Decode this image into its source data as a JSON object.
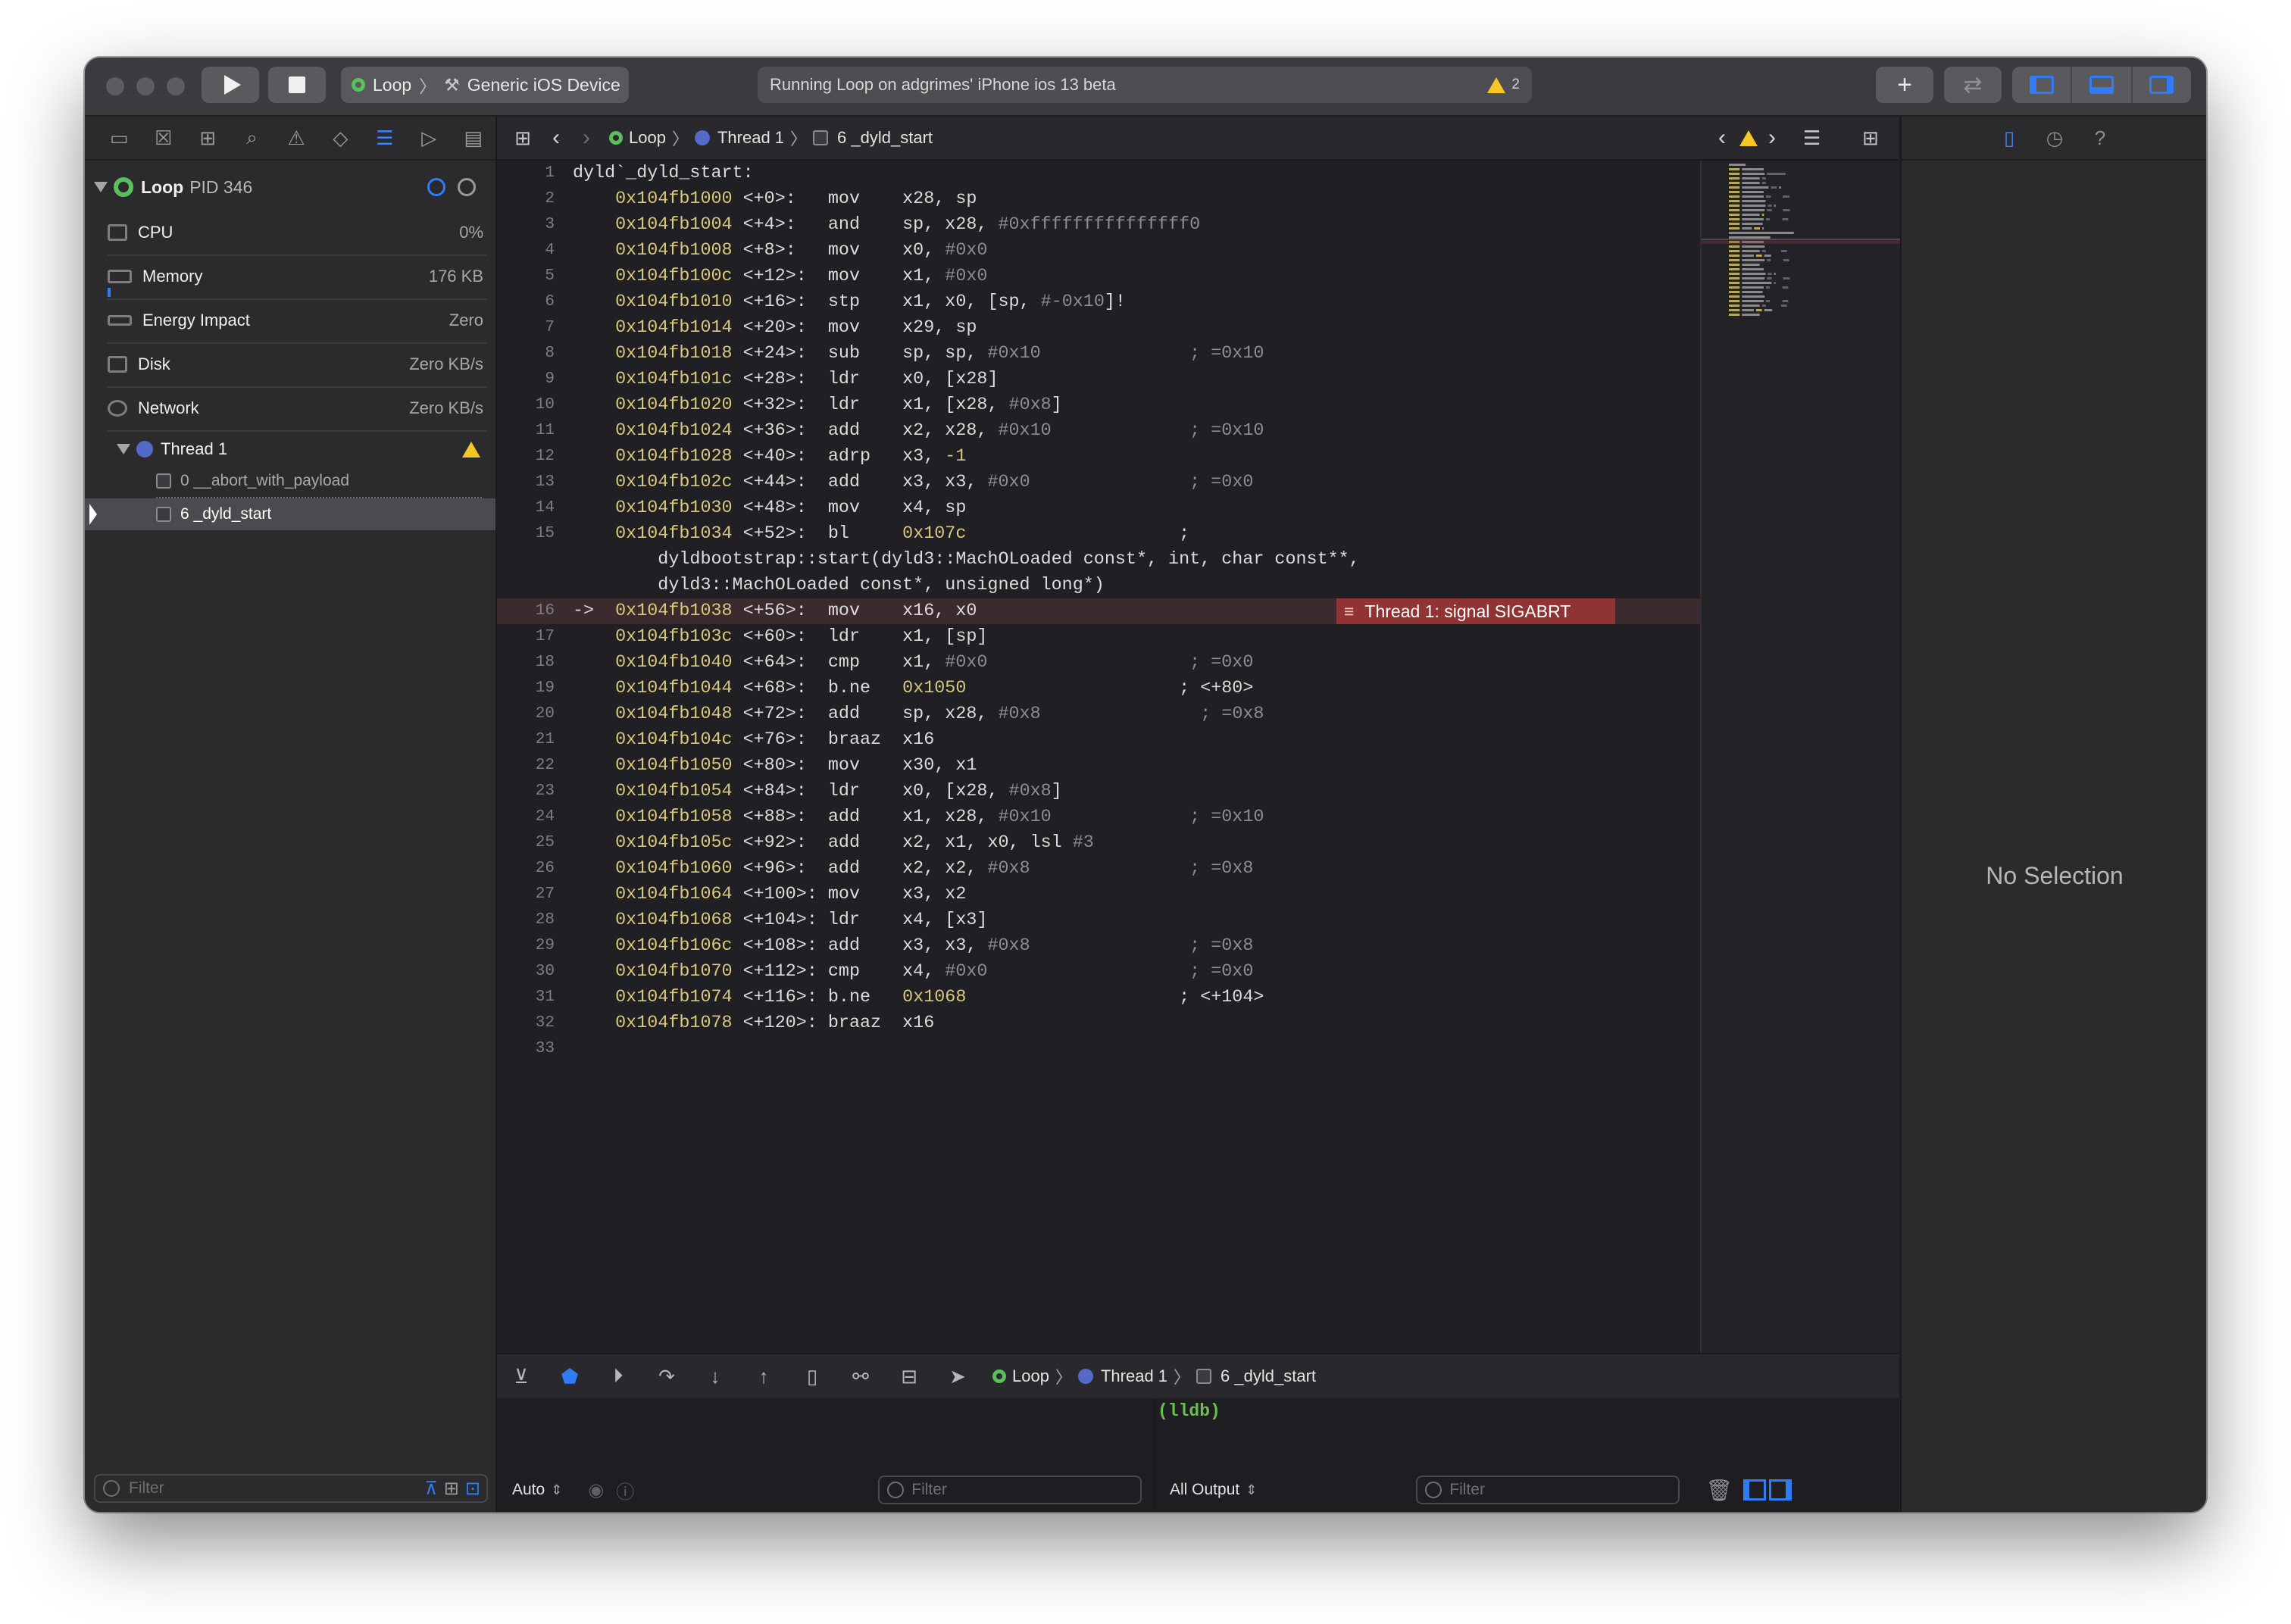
{
  "toolbar": {
    "scheme": {
      "target": "Loop",
      "device": "Generic iOS Device"
    },
    "status_text": "Running Loop on adgrimes' iPhone ios 13 beta",
    "warning_count": "2"
  },
  "navigator": {
    "process": {
      "name": "Loop",
      "pid": "PID 346"
    },
    "gauges": [
      {
        "label": "CPU",
        "value": "0%"
      },
      {
        "label": "Memory",
        "value": "176 KB"
      },
      {
        "label": "Energy Impact",
        "value": "Zero"
      },
      {
        "label": "Disk",
        "value": "Zero KB/s"
      },
      {
        "label": "Network",
        "value": "Zero KB/s"
      }
    ],
    "thread": {
      "name": "Thread 1"
    },
    "frames": [
      {
        "label": "0 __abort_with_payload"
      },
      {
        "label": "6 _dyld_start"
      }
    ],
    "filter_placeholder": "Filter"
  },
  "jumpbar": {
    "project": "Loop",
    "thread": "Thread 1",
    "frame": "6 _dyld_start"
  },
  "code": {
    "lines": [
      {
        "n": "1",
        "parts": [
          [
            "t",
            "dyld`_dyld_start:"
          ]
        ]
      },
      {
        "n": "2",
        "parts": [
          [
            "a",
            "    0x104fb1000"
          ],
          [
            "t",
            " <+0>:   mov    x28, sp"
          ]
        ]
      },
      {
        "n": "3",
        "parts": [
          [
            "a",
            "    0x104fb1004"
          ],
          [
            "t",
            " <+4>:   and    sp, x28, "
          ],
          [
            "i",
            "#0xfffffffffffffff0"
          ]
        ]
      },
      {
        "n": "4",
        "parts": [
          [
            "a",
            "    0x104fb1008"
          ],
          [
            "t",
            " <+8>:   mov    x0, "
          ],
          [
            "i",
            "#0x0"
          ]
        ]
      },
      {
        "n": "5",
        "parts": [
          [
            "a",
            "    0x104fb100c"
          ],
          [
            "t",
            " <+12>:  mov    x1, "
          ],
          [
            "i",
            "#0x0"
          ]
        ]
      },
      {
        "n": "6",
        "parts": [
          [
            "a",
            "    0x104fb1010"
          ],
          [
            "t",
            " <+16>:  stp    x1, x0, [sp, "
          ],
          [
            "i",
            "#-0x10"
          ],
          [
            "t",
            "]!"
          ]
        ]
      },
      {
        "n": "7",
        "parts": [
          [
            "a",
            "    0x104fb1014"
          ],
          [
            "t",
            " <+20>:  mov    x29, sp"
          ]
        ]
      },
      {
        "n": "8",
        "parts": [
          [
            "a",
            "    0x104fb1018"
          ],
          [
            "t",
            " <+24>:  sub    sp, sp, "
          ],
          [
            "i",
            "#0x10"
          ],
          [
            "t",
            "              "
          ],
          [
            "c",
            "; =0x10"
          ]
        ]
      },
      {
        "n": "9",
        "parts": [
          [
            "a",
            "    0x104fb101c"
          ],
          [
            "t",
            " <+28>:  ldr    x0, [x28]"
          ]
        ]
      },
      {
        "n": "10",
        "parts": [
          [
            "a",
            "    0x104fb1020"
          ],
          [
            "t",
            " <+32>:  ldr    x1, [x28, "
          ],
          [
            "i",
            "#0x8"
          ],
          [
            "t",
            "]"
          ]
        ]
      },
      {
        "n": "11",
        "parts": [
          [
            "a",
            "    0x104fb1024"
          ],
          [
            "t",
            " <+36>:  add    x2, x28, "
          ],
          [
            "i",
            "#0x10"
          ],
          [
            "t",
            "             "
          ],
          [
            "c",
            "; =0x10"
          ]
        ]
      },
      {
        "n": "12",
        "parts": [
          [
            "a",
            "    0x104fb1028"
          ],
          [
            "t",
            " <+40>:  adrp   x3, "
          ],
          [
            "a",
            "-1"
          ]
        ]
      },
      {
        "n": "13",
        "parts": [
          [
            "a",
            "    0x104fb102c"
          ],
          [
            "t",
            " <+44>:  add    x3, x3, "
          ],
          [
            "i",
            "#0x0"
          ],
          [
            "t",
            "               "
          ],
          [
            "c",
            "; =0x0"
          ]
        ]
      },
      {
        "n": "14",
        "parts": [
          [
            "a",
            "    0x104fb1030"
          ],
          [
            "t",
            " <+48>:  mov    x4, sp"
          ]
        ]
      },
      {
        "n": "15",
        "parts": [
          [
            "a",
            "    0x104fb1034"
          ],
          [
            "t",
            " <+52>:  bl     "
          ],
          [
            "a",
            "0x107c"
          ],
          [
            "t",
            "                    ;"
          ]
        ]
      },
      {
        "n": "",
        "parts": [
          [
            "t",
            "        dyldbootstrap::start(dyld3::MachOLoaded const*, int, char const**,"
          ]
        ]
      },
      {
        "n": "",
        "parts": [
          [
            "t",
            "        dyld3::MachOLoaded const*, unsigned long*)"
          ]
        ]
      },
      {
        "n": "16",
        "arrow": "->",
        "highlight": true,
        "parts": [
          [
            "a",
            "    0x104fb1038"
          ],
          [
            "t",
            " <+56>:  mov    x16, x0"
          ]
        ]
      },
      {
        "n": "17",
        "parts": [
          [
            "a",
            "    0x104fb103c"
          ],
          [
            "t",
            " <+60>:  ldr    x1, [sp]"
          ]
        ]
      },
      {
        "n": "18",
        "parts": [
          [
            "a",
            "    0x104fb1040"
          ],
          [
            "t",
            " <+64>:  cmp    x1, "
          ],
          [
            "i",
            "#0x0"
          ],
          [
            "t",
            "                   "
          ],
          [
            "c",
            "; =0x0"
          ]
        ]
      },
      {
        "n": "19",
        "parts": [
          [
            "a",
            "    0x104fb1044"
          ],
          [
            "t",
            " <+68>:  b.ne   "
          ],
          [
            "a",
            "0x1050"
          ],
          [
            "t",
            "                    ; <+80>"
          ]
        ]
      },
      {
        "n": "20",
        "parts": [
          [
            "a",
            "    0x104fb1048"
          ],
          [
            "t",
            " <+72>:  add    sp, x28, "
          ],
          [
            "i",
            "#0x8"
          ],
          [
            "t",
            "               "
          ],
          [
            "c",
            "; =0x8"
          ]
        ]
      },
      {
        "n": "21",
        "parts": [
          [
            "a",
            "    0x104fb104c"
          ],
          [
            "t",
            " <+76>:  braaz  x16"
          ]
        ]
      },
      {
        "n": "22",
        "parts": [
          [
            "a",
            "    0x104fb1050"
          ],
          [
            "t",
            " <+80>:  mov    x30, x1"
          ]
        ]
      },
      {
        "n": "23",
        "parts": [
          [
            "a",
            "    0x104fb1054"
          ],
          [
            "t",
            " <+84>:  ldr    x0, [x28, "
          ],
          [
            "i",
            "#0x8"
          ],
          [
            "t",
            "]"
          ]
        ]
      },
      {
        "n": "24",
        "parts": [
          [
            "a",
            "    0x104fb1058"
          ],
          [
            "t",
            " <+88>:  add    x1, x28, "
          ],
          [
            "i",
            "#0x10"
          ],
          [
            "t",
            "             "
          ],
          [
            "c",
            "; =0x10"
          ]
        ]
      },
      {
        "n": "25",
        "parts": [
          [
            "a",
            "    0x104fb105c"
          ],
          [
            "t",
            " <+92>:  add    x2, x1, x0, lsl "
          ],
          [
            "i",
            "#3"
          ]
        ]
      },
      {
        "n": "26",
        "parts": [
          [
            "a",
            "    0x104fb1060"
          ],
          [
            "t",
            " <+96>:  add    x2, x2, "
          ],
          [
            "i",
            "#0x8"
          ],
          [
            "t",
            "               "
          ],
          [
            "c",
            "; =0x8"
          ]
        ]
      },
      {
        "n": "27",
        "parts": [
          [
            "a",
            "    0x104fb1064"
          ],
          [
            "t",
            " <+100>: mov    x3, x2"
          ]
        ]
      },
      {
        "n": "28",
        "parts": [
          [
            "a",
            "    0x104fb1068"
          ],
          [
            "t",
            " <+104>: ldr    x4, [x3]"
          ]
        ]
      },
      {
        "n": "29",
        "parts": [
          [
            "a",
            "    0x104fb106c"
          ],
          [
            "t",
            " <+108>: add    x3, x3, "
          ],
          [
            "i",
            "#0x8"
          ],
          [
            "t",
            "               "
          ],
          [
            "c",
            "; =0x8"
          ]
        ]
      },
      {
        "n": "30",
        "parts": [
          [
            "a",
            "    0x104fb1070"
          ],
          [
            "t",
            " <+112>: cmp    x4, "
          ],
          [
            "i",
            "#0x0"
          ],
          [
            "t",
            "                   "
          ],
          [
            "c",
            "; =0x0"
          ]
        ]
      },
      {
        "n": "31",
        "parts": [
          [
            "a",
            "    0x104fb1074"
          ],
          [
            "t",
            " <+116>: b.ne   "
          ],
          [
            "a",
            "0x1068"
          ],
          [
            "t",
            "                    ; <+104>"
          ]
        ]
      },
      {
        "n": "32",
        "parts": [
          [
            "a",
            "    0x104fb1078"
          ],
          [
            "t",
            " <+120>: braaz  x16"
          ]
        ]
      },
      {
        "n": "33",
        "parts": []
      }
    ],
    "annotation": "Thread 1: signal SIGABRT"
  },
  "debug": {
    "project": "Loop",
    "thread": "Thread 1",
    "frame": "6 _dyld_start"
  },
  "variables": {
    "mode": "Auto",
    "filter_placeholder": "Filter"
  },
  "console": {
    "prompt": "(lldb)",
    "output_mode": "All Output",
    "filter_placeholder": "Filter"
  },
  "inspector": {
    "empty_text": "No Selection"
  },
  "colors": {
    "accent": "#2f7cf6",
    "warning": "#f4c724",
    "error_line": "#8f3334",
    "running": "#59c05b",
    "address": "#d9c97c"
  }
}
